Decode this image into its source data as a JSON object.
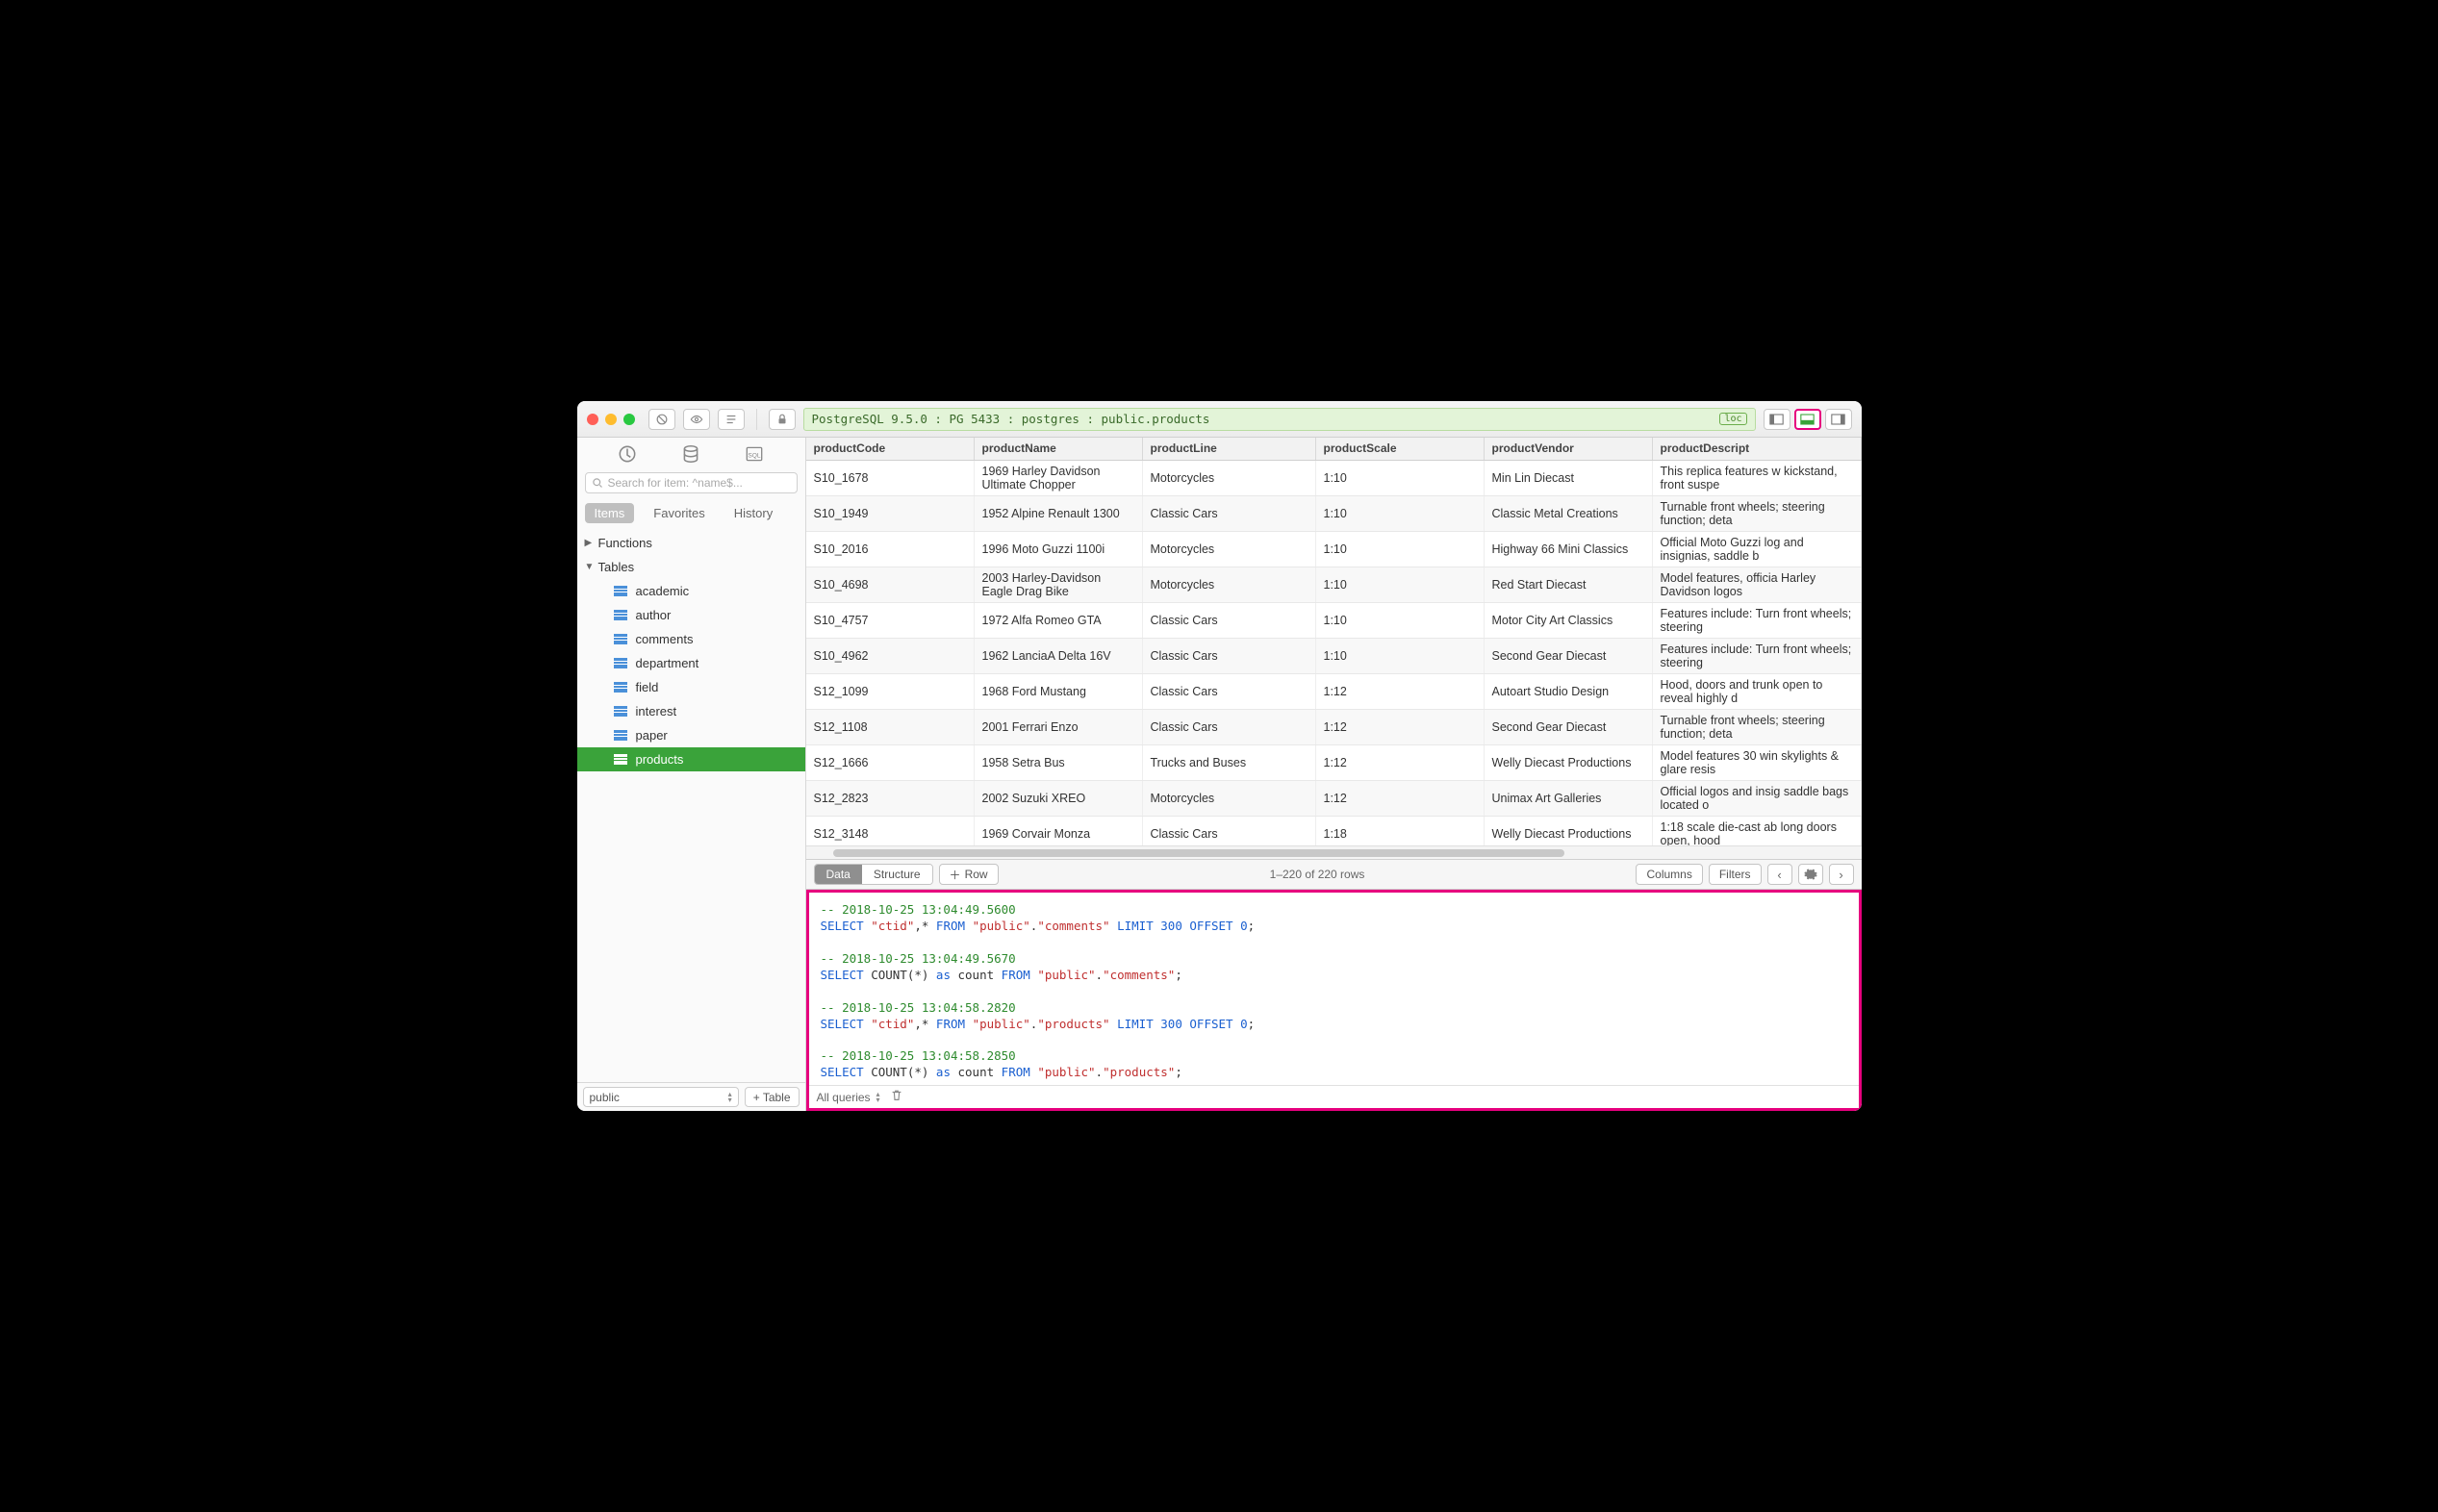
{
  "breadcrumb": "PostgreSQL 9.5.0 : PG 5433 : postgres : public.products",
  "loc_badge": "loc",
  "sidebar": {
    "search_placeholder": "Search for item: ^name$...",
    "tabs": [
      "Items",
      "Favorites",
      "History"
    ],
    "tree": {
      "functions": "Functions",
      "tables": "Tables",
      "items": [
        "academic",
        "author",
        "comments",
        "department",
        "field",
        "interest",
        "paper",
        "products"
      ],
      "selected": "products"
    },
    "schema": "public",
    "add_table": "+ Table"
  },
  "columns": [
    "productCode",
    "productName",
    "productLine",
    "productScale",
    "productVendor",
    "productDescript"
  ],
  "rows": [
    {
      "c": [
        "S10_1678",
        "1969 Harley Davidson Ultimate Chopper",
        "Motorcycles",
        "1:10",
        "Min Lin Diecast",
        "This replica features w kickstand, front suspe"
      ]
    },
    {
      "c": [
        "S10_1949",
        "1952 Alpine Renault 1300",
        "Classic Cars",
        "1:10",
        "Classic Metal Creations",
        "Turnable front wheels; steering function; deta"
      ]
    },
    {
      "c": [
        "S10_2016",
        "1996 Moto Guzzi 1100i",
        "Motorcycles",
        "1:10",
        "Highway 66 Mini Classics",
        "Official Moto Guzzi log and insignias, saddle b"
      ]
    },
    {
      "c": [
        "S10_4698",
        "2003 Harley-Davidson Eagle Drag Bike",
        "Motorcycles",
        "1:10",
        "Red Start Diecast",
        "Model features, officia Harley Davidson logos"
      ]
    },
    {
      "c": [
        "S10_4757",
        "1972 Alfa Romeo GTA",
        "Classic Cars",
        "1:10",
        "Motor City Art Classics",
        "Features include: Turn front wheels; steering"
      ]
    },
    {
      "c": [
        "S10_4962",
        "1962 LanciaA Delta 16V",
        "Classic Cars",
        "1:10",
        "Second Gear Diecast",
        "Features include: Turn front wheels; steering"
      ]
    },
    {
      "c": [
        "S12_1099",
        "1968 Ford Mustang",
        "Classic Cars",
        "1:12",
        "Autoart Studio Design",
        "Hood, doors and trunk open to reveal highly d"
      ]
    },
    {
      "c": [
        "S12_1108",
        "2001 Ferrari Enzo",
        "Classic Cars",
        "1:12",
        "Second Gear Diecast",
        "Turnable front wheels; steering function; deta"
      ]
    },
    {
      "c": [
        "S12_1666",
        "1958 Setra Bus",
        "Trucks and Buses",
        "1:12",
        "Welly Diecast Productions",
        "Model features 30 win skylights & glare resis"
      ]
    },
    {
      "c": [
        "S12_2823",
        "2002 Suzuki XREO",
        "Motorcycles",
        "1:12",
        "Unimax Art Galleries",
        "Official logos and insig saddle bags located o"
      ]
    },
    {
      "c": [
        "S12_3148",
        "1969 Corvair Monza",
        "Classic Cars",
        "1:18",
        "Welly Diecast Productions",
        "1:18 scale die-cast ab long doors open, hood"
      ]
    }
  ],
  "toolbar": {
    "data": "Data",
    "structure": "Structure",
    "add_row": "Row",
    "status": "1–220 of 220 rows",
    "columns": "Columns",
    "filters": "Filters"
  },
  "console": {
    "lines": [
      {
        "ts": "-- 2018-10-25 13:04:49.5600",
        "sql": [
          [
            "kw",
            "SELECT "
          ],
          [
            "str",
            "\"ctid\""
          ],
          [
            "",
            ",* "
          ],
          [
            "kw",
            "FROM "
          ],
          [
            "str",
            "\"public\""
          ],
          [
            "",
            "."
          ],
          [
            "str",
            "\"comments\""
          ],
          [
            "",
            " "
          ],
          [
            "kw",
            "LIMIT"
          ],
          [
            "",
            " "
          ],
          [
            "num",
            "300"
          ],
          [
            "",
            " "
          ],
          [
            "kw",
            "OFFSET"
          ],
          [
            "",
            " "
          ],
          [
            "num",
            "0"
          ],
          [
            "",
            ";"
          ]
        ]
      },
      {
        "ts": "-- 2018-10-25 13:04:49.5670",
        "sql": [
          [
            "kw",
            "SELECT "
          ],
          [
            "",
            "COUNT(*) "
          ],
          [
            "kw",
            "as"
          ],
          [
            "",
            " count "
          ],
          [
            "kw",
            "FROM "
          ],
          [
            "str",
            "\"public\""
          ],
          [
            "",
            "."
          ],
          [
            "str",
            "\"comments\""
          ],
          [
            "",
            ";"
          ]
        ]
      },
      {
        "ts": "-- 2018-10-25 13:04:58.2820",
        "sql": [
          [
            "kw",
            "SELECT "
          ],
          [
            "str",
            "\"ctid\""
          ],
          [
            "",
            ",* "
          ],
          [
            "kw",
            "FROM "
          ],
          [
            "str",
            "\"public\""
          ],
          [
            "",
            "."
          ],
          [
            "str",
            "\"products\""
          ],
          [
            "",
            " "
          ],
          [
            "kw",
            "LIMIT"
          ],
          [
            "",
            " "
          ],
          [
            "num",
            "300"
          ],
          [
            "",
            " "
          ],
          [
            "kw",
            "OFFSET"
          ],
          [
            "",
            " "
          ],
          [
            "num",
            "0"
          ],
          [
            "",
            ";"
          ]
        ]
      },
      {
        "ts": "-- 2018-10-25 13:04:58.2850",
        "sql": [
          [
            "kw",
            "SELECT "
          ],
          [
            "",
            "COUNT(*) "
          ],
          [
            "kw",
            "as"
          ],
          [
            "",
            " count "
          ],
          [
            "kw",
            "FROM "
          ],
          [
            "str",
            "\"public\""
          ],
          [
            "",
            "."
          ],
          [
            "str",
            "\"products\""
          ],
          [
            "",
            ";"
          ]
        ]
      }
    ],
    "filter": "All queries"
  }
}
